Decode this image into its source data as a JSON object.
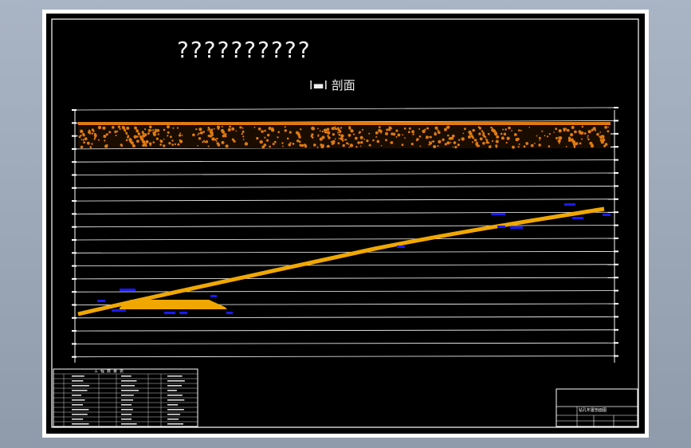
{
  "drawing": {
    "title": "??????????",
    "section_label": "I▬I 剖面",
    "legend_title": "工程数量表",
    "title_block_label": "钻孔布置剖面图"
  },
  "colors": {
    "background": "#000000",
    "frame": "#ffffff",
    "grid_line": "#ffffff",
    "soil_layer": "#e07a10",
    "bore_path": "#f0a800",
    "annotation": "#1a1aff",
    "window_bg": "#9aa6b6"
  }
}
